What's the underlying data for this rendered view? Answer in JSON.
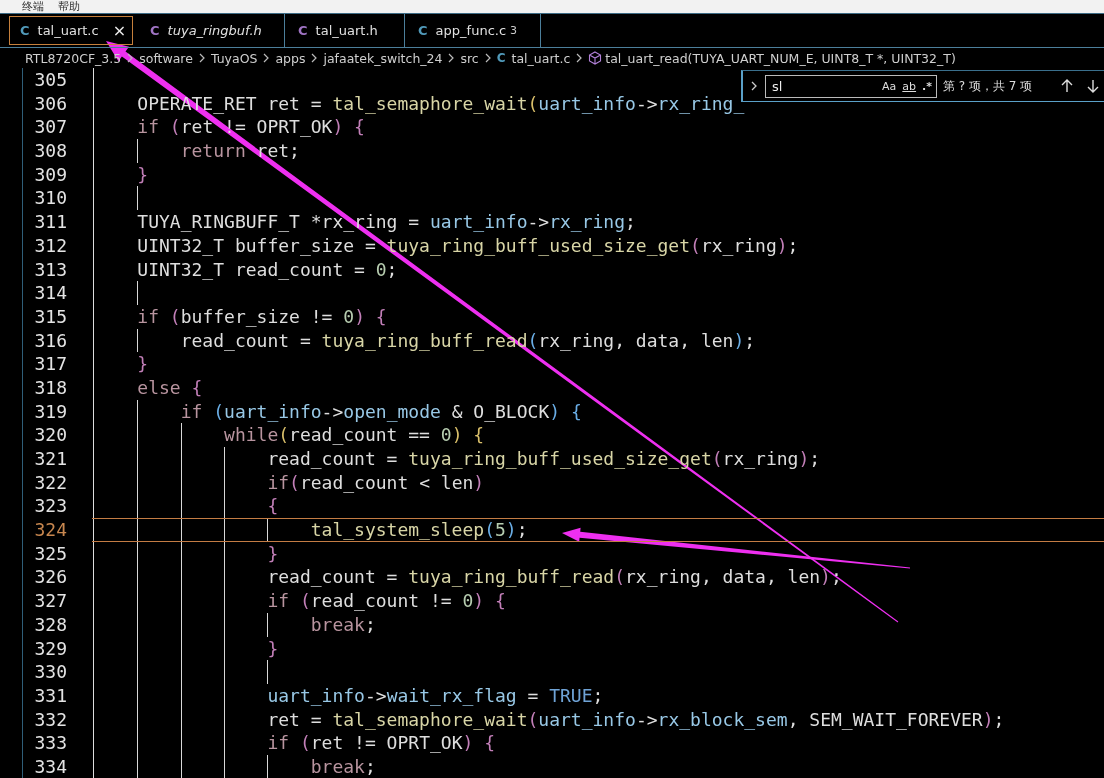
{
  "menu_bar": {
    "items": [
      "终端",
      "帮助"
    ]
  },
  "tabs": [
    {
      "label": "tal_uart.c",
      "icon": "C",
      "kind": "source",
      "selected": true,
      "preview": false,
      "close": "×"
    },
    {
      "label": "tuya_ringbuf.h",
      "icon": "C",
      "kind": "header",
      "selected": false,
      "preview": true
    },
    {
      "label": "tal_uart.h",
      "icon": "C",
      "kind": "header",
      "selected": false,
      "preview": false
    },
    {
      "label": "app_func.c",
      "icon": "C",
      "kind": "source",
      "selected": false,
      "preview": false,
      "badge": "3"
    }
  ],
  "breadcrumbs": [
    {
      "label": "RTL8720CF_3.5",
      "kind": "folder"
    },
    {
      "label": "software",
      "kind": "folder"
    },
    {
      "label": "TuyaOS",
      "kind": "folder"
    },
    {
      "label": "apps",
      "kind": "folder"
    },
    {
      "label": "jafaatek_switch_24",
      "kind": "folder"
    },
    {
      "label": "src",
      "kind": "folder"
    },
    {
      "label": "tal_uart.c",
      "kind": "file",
      "icon": "C"
    },
    {
      "label": "tal_uart_read(TUYA_UART_NUM_E, UINT8_T *, UINT32_T)",
      "kind": "symbol"
    }
  ],
  "find_widget": {
    "value": "sl",
    "options": [
      "Aa",
      "ab",
      ".*"
    ],
    "result": "第 ? 项，共 7 项"
  },
  "lines": [
    {
      "number": "305",
      "current": false
    },
    {
      "number": "306",
      "current": false,
      "tokens": [
        {
          "text": "    OPERATE_RET ret = ",
          "kind": "plain"
        },
        {
          "text": "tal_semaphore_wait",
          "kind": "function"
        },
        {
          "text": "(",
          "kind": "bracket1"
        },
        {
          "text": "uart_info",
          "kind": "member"
        },
        {
          "text": "->",
          "kind": "plain"
        },
        {
          "text": "rx_ring_",
          "kind": "member"
        }
      ]
    },
    {
      "number": "307",
      "current": false,
      "tokens": [
        {
          "text": "    if",
          "kind": "keyword"
        },
        {
          "text": " (",
          "kind": "bracket2"
        },
        {
          "text": "ret != OPRT_OK",
          "kind": "plain"
        },
        {
          "text": ") {",
          "kind": "bracket2"
        }
      ]
    },
    {
      "number": "308",
      "current": false,
      "tokens": [
        {
          "text": "        return",
          "kind": "keyword"
        },
        {
          "text": " ret;",
          "kind": "plain"
        }
      ]
    },
    {
      "number": "309",
      "current": false,
      "tokens": [
        {
          "text": "    }",
          "kind": "bracket2"
        }
      ]
    },
    {
      "number": "310",
      "current": false
    },
    {
      "number": "311",
      "current": false,
      "tokens": [
        {
          "text": "    TUYA_RINGBUFF_T *rx_ring = ",
          "kind": "plain"
        },
        {
          "text": "uart_info",
          "kind": "member"
        },
        {
          "text": "->",
          "kind": "plain"
        },
        {
          "text": "rx_ring",
          "kind": "member"
        },
        {
          "text": ";",
          "kind": "plain"
        }
      ]
    },
    {
      "number": "312",
      "current": false,
      "tokens": [
        {
          "text": "    UINT32_T buffer_size = ",
          "kind": "plain"
        },
        {
          "text": "tuya_ring_buff_used_size_get",
          "kind": "function"
        },
        {
          "text": "(",
          "kind": "bracket2"
        },
        {
          "text": "rx_ring",
          "kind": "plain"
        },
        {
          "text": ")",
          "kind": "bracket2"
        },
        {
          "text": ";",
          "kind": "plain"
        }
      ]
    },
    {
      "number": "313",
      "current": false,
      "tokens": [
        {
          "text": "    UINT32_T read_count = ",
          "kind": "plain"
        },
        {
          "text": "0",
          "kind": "number"
        },
        {
          "text": ";",
          "kind": "plain"
        }
      ]
    },
    {
      "number": "314",
      "current": false
    },
    {
      "number": "315",
      "current": false,
      "tokens": [
        {
          "text": "    if",
          "kind": "keyword"
        },
        {
          "text": " (",
          "kind": "bracket2"
        },
        {
          "text": "buffer_size != ",
          "kind": "plain"
        },
        {
          "text": "0",
          "kind": "number"
        },
        {
          "text": ") {",
          "kind": "bracket2"
        }
      ]
    },
    {
      "number": "316",
      "current": false,
      "tokens": [
        {
          "text": "        read_count = ",
          "kind": "plain"
        },
        {
          "text": "tuya_ring_buff_read",
          "kind": "function"
        },
        {
          "text": "(",
          "kind": "bracket3"
        },
        {
          "text": "rx_ring, data, len",
          "kind": "plain"
        },
        {
          "text": ")",
          "kind": "bracket3"
        },
        {
          "text": ";",
          "kind": "plain"
        }
      ]
    },
    {
      "number": "317",
      "current": false,
      "tokens": [
        {
          "text": "    }",
          "kind": "bracket2"
        }
      ]
    },
    {
      "number": "318",
      "current": false,
      "tokens": [
        {
          "text": "    else",
          "kind": "keyword"
        },
        {
          "text": " {",
          "kind": "bracket2"
        }
      ]
    },
    {
      "number": "319",
      "current": false,
      "tokens": [
        {
          "text": "        if",
          "kind": "keyword"
        },
        {
          "text": " (",
          "kind": "bracket3"
        },
        {
          "text": "uart_info",
          "kind": "member"
        },
        {
          "text": "->",
          "kind": "plain"
        },
        {
          "text": "open_mode",
          "kind": "member"
        },
        {
          "text": " & O_BLOCK",
          "kind": "plain"
        },
        {
          "text": ") {",
          "kind": "bracket3"
        }
      ]
    },
    {
      "number": "320",
      "current": false,
      "tokens": [
        {
          "text": "            while",
          "kind": "keyword"
        },
        {
          "text": "(",
          "kind": "bracket1"
        },
        {
          "text": "read_count == ",
          "kind": "plain"
        },
        {
          "text": "0",
          "kind": "number"
        },
        {
          "text": ") {",
          "kind": "bracket1"
        }
      ]
    },
    {
      "number": "321",
      "current": false,
      "tokens": [
        {
          "text": "                read_count = ",
          "kind": "plain"
        },
        {
          "text": "tuya_ring_buff_used_size_get",
          "kind": "function"
        },
        {
          "text": "(",
          "kind": "bracket2"
        },
        {
          "text": "rx_ring",
          "kind": "plain"
        },
        {
          "text": ")",
          "kind": "bracket2"
        },
        {
          "text": ";",
          "kind": "plain"
        }
      ]
    },
    {
      "number": "322",
      "current": false,
      "tokens": [
        {
          "text": "                if",
          "kind": "keyword"
        },
        {
          "text": "(",
          "kind": "bracket2"
        },
        {
          "text": "read_count < len",
          "kind": "plain"
        },
        {
          "text": ")",
          "kind": "bracket2"
        }
      ]
    },
    {
      "number": "323",
      "current": false,
      "tokens": [
        {
          "text": "                {",
          "kind": "bracket2"
        }
      ]
    },
    {
      "number": "324",
      "current": true,
      "tokens": [
        {
          "text": "                    tal_system_sleep",
          "kind": "function"
        },
        {
          "text": "(",
          "kind": "bracket3"
        },
        {
          "text": "5",
          "kind": "number"
        },
        {
          "text": ")",
          "kind": "bracket3"
        },
        {
          "text": ";",
          "kind": "plain"
        }
      ]
    },
    {
      "number": "325",
      "current": false,
      "tokens": [
        {
          "text": "                }",
          "kind": "bracket2"
        }
      ]
    },
    {
      "number": "326",
      "current": false,
      "tokens": [
        {
          "text": "                read_count = ",
          "kind": "plain"
        },
        {
          "text": "tuya_ring_buff_read",
          "kind": "function"
        },
        {
          "text": "(",
          "kind": "bracket2"
        },
        {
          "text": "rx_ring, data, len",
          "kind": "plain"
        },
        {
          "text": ")",
          "kind": "bracket2"
        },
        {
          "text": ";",
          "kind": "plain"
        }
      ]
    },
    {
      "number": "327",
      "current": false,
      "tokens": [
        {
          "text": "                if",
          "kind": "keyword"
        },
        {
          "text": " (",
          "kind": "bracket2"
        },
        {
          "text": "read_count != ",
          "kind": "plain"
        },
        {
          "text": "0",
          "kind": "number"
        },
        {
          "text": ") {",
          "kind": "bracket2"
        }
      ]
    },
    {
      "number": "328",
      "current": false,
      "tokens": [
        {
          "text": "                    break",
          "kind": "keyword"
        },
        {
          "text": ";",
          "kind": "plain"
        }
      ]
    },
    {
      "number": "329",
      "current": false,
      "tokens": [
        {
          "text": "                }",
          "kind": "bracket2"
        }
      ]
    },
    {
      "number": "330",
      "current": false
    },
    {
      "number": "331",
      "current": false,
      "tokens": [
        {
          "text": "                uart_info",
          "kind": "member"
        },
        {
          "text": "->",
          "kind": "plain"
        },
        {
          "text": "wait_rx_flag",
          "kind": "member"
        },
        {
          "text": " = ",
          "kind": "plain"
        },
        {
          "text": "TRUE",
          "kind": "constant"
        },
        {
          "text": ";",
          "kind": "plain"
        }
      ]
    },
    {
      "number": "332",
      "current": false,
      "tokens": [
        {
          "text": "                ret = ",
          "kind": "plain"
        },
        {
          "text": "tal_semaphore_wait",
          "kind": "function"
        },
        {
          "text": "(",
          "kind": "bracket2"
        },
        {
          "text": "uart_info",
          "kind": "member"
        },
        {
          "text": "->",
          "kind": "plain"
        },
        {
          "text": "rx_block_sem",
          "kind": "member"
        },
        {
          "text": ", SEM_WAIT_FOREVER",
          "kind": "plain"
        },
        {
          "text": ")",
          "kind": "bracket2"
        },
        {
          "text": ";",
          "kind": "plain"
        }
      ]
    },
    {
      "number": "333",
      "current": false,
      "tokens": [
        {
          "text": "                if",
          "kind": "keyword"
        },
        {
          "text": " (",
          "kind": "bracket2"
        },
        {
          "text": "ret != OPRT_OK",
          "kind": "plain"
        },
        {
          "text": ") {",
          "kind": "bracket2"
        }
      ]
    },
    {
      "number": "334",
      "current": false,
      "tokens": [
        {
          "text": "                    break",
          "kind": "keyword"
        },
        {
          "text": ";",
          "kind": "plain"
        }
      ]
    }
  ],
  "annotations": [
    {
      "kind": "arrow"
    },
    {
      "kind": "arrow"
    }
  ]
}
